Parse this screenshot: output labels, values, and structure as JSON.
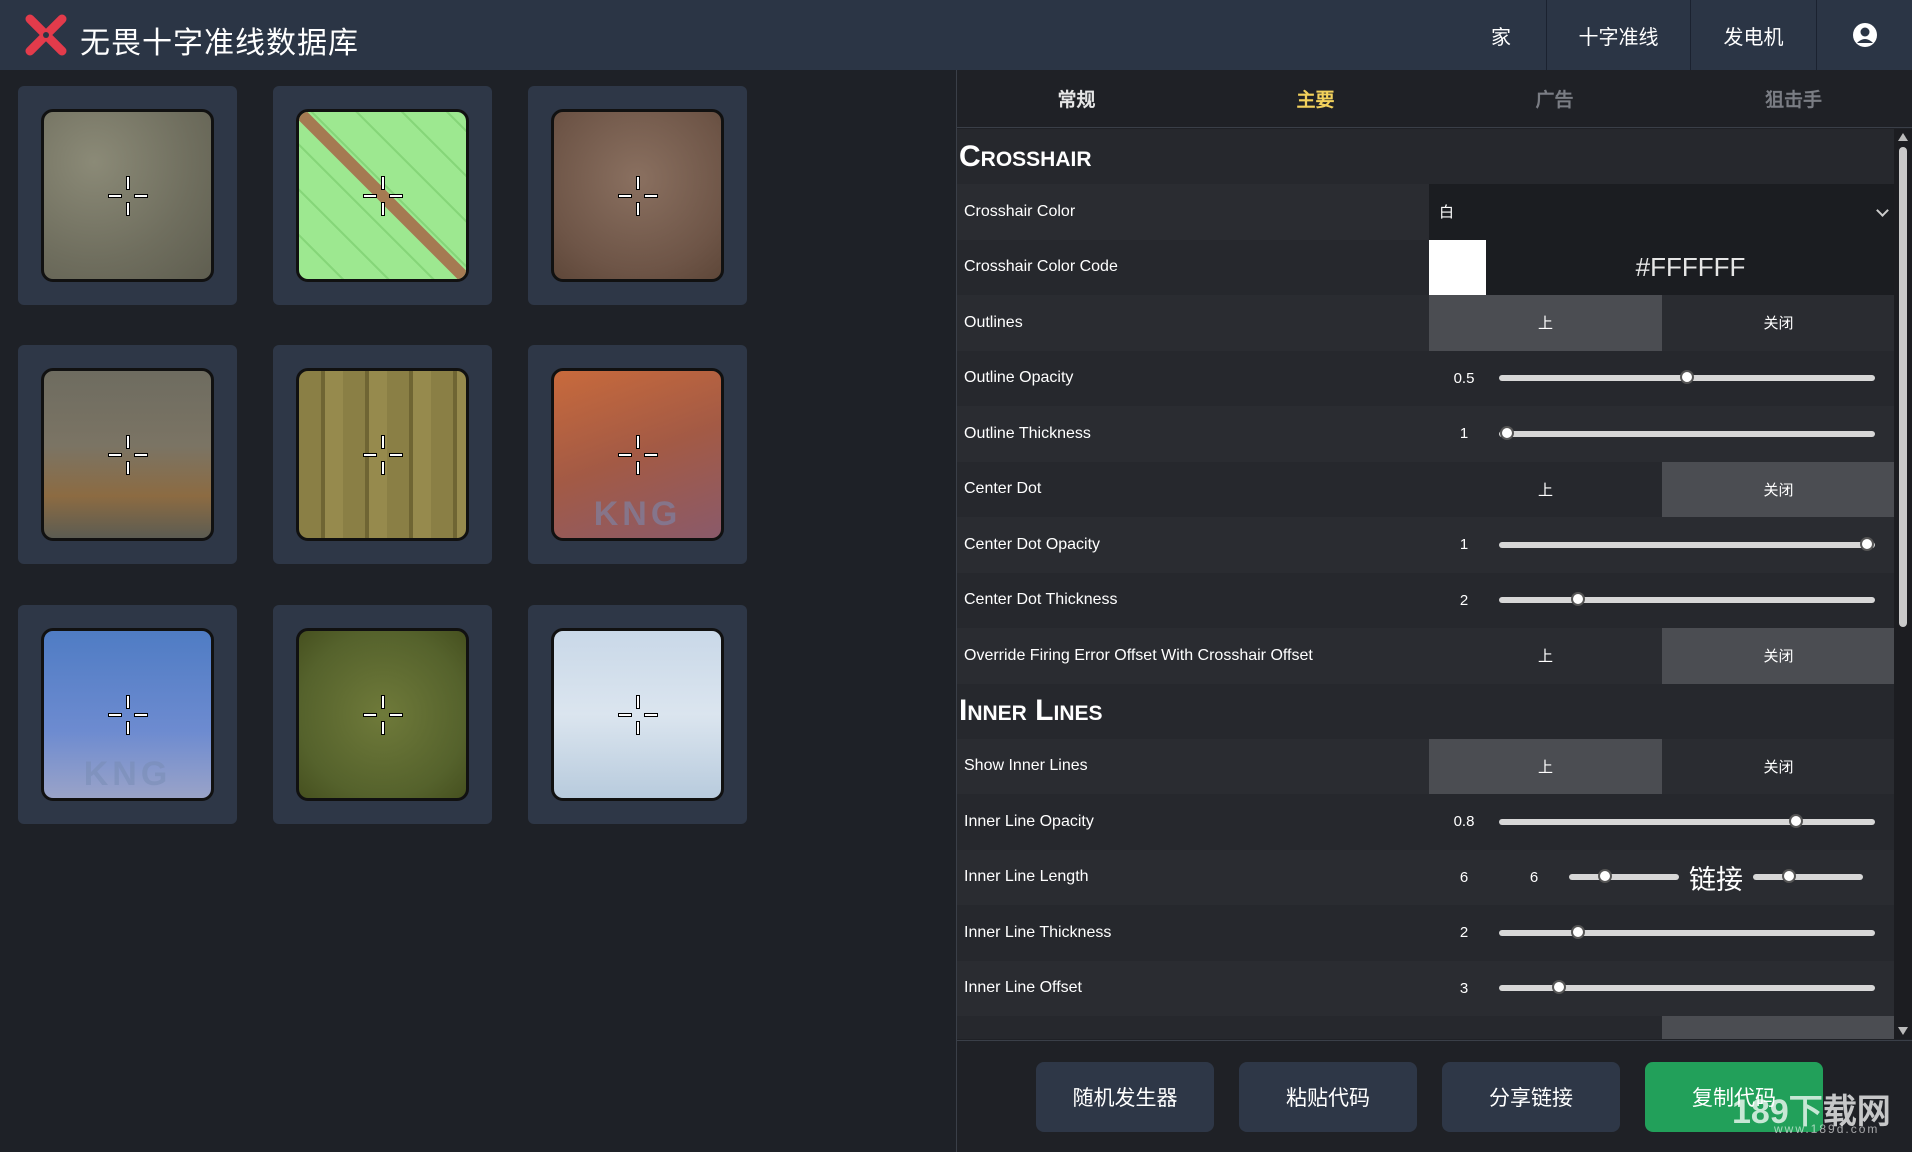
{
  "app": {
    "title": "无畏十字准线数据库"
  },
  "nav": {
    "home": "家",
    "crosshair": "十字准线",
    "generator": "发电机"
  },
  "grid": {
    "tiles": [
      {
        "bg": "bg1"
      },
      {
        "bg": "bg2"
      },
      {
        "bg": "bg3"
      },
      {
        "bg": "bg4"
      },
      {
        "bg": "bg5"
      },
      {
        "bg": "bg6",
        "logo_text": "KNG"
      },
      {
        "bg": "bg7",
        "logo_text": "KNG"
      },
      {
        "bg": "bg8"
      },
      {
        "bg": "bg9"
      }
    ]
  },
  "tabs": {
    "general": "常规",
    "primary": "主要",
    "ads": "广告",
    "sniper": "狙击手",
    "active": "primary"
  },
  "sections": {
    "crosshair": "Crosshair",
    "inner_lines": "Inner Lines"
  },
  "toggle": {
    "on": "上",
    "off": "关闭"
  },
  "crosshair": {
    "color": {
      "label": "Crosshair Color",
      "value": "白"
    },
    "color_code": {
      "label": "Crosshair Color Code",
      "value": "#FFFFFF",
      "swatch": "#ffffff"
    },
    "outlines": {
      "label": "Outlines",
      "state": "on"
    },
    "outline_opacity": {
      "label": "Outline Opacity",
      "value": "0.5",
      "fraction": 0.5
    },
    "outline_thickness": {
      "label": "Outline Thickness",
      "value": "1",
      "fraction": 0.02
    },
    "center_dot": {
      "label": "Center Dot",
      "state": "off"
    },
    "center_dot_opacity": {
      "label": "Center Dot Opacity",
      "value": "1",
      "fraction": 0.98
    },
    "center_dot_thickness": {
      "label": "Center Dot Thickness",
      "value": "2",
      "fraction": 0.21
    },
    "override_firing": {
      "label": "Override Firing Error Offset With Crosshair Offset",
      "state": "off"
    }
  },
  "inner": {
    "show": {
      "label": "Show Inner Lines",
      "state": "on"
    },
    "opacity": {
      "label": "Inner Line Opacity",
      "value": "0.8",
      "fraction": 0.79
    },
    "length": {
      "label": "Inner Line Length",
      "value": "6",
      "value2": "6",
      "fraction": 0.33,
      "fraction2": 0.33,
      "link_label": "链接"
    },
    "thickness": {
      "label": "Inner Line Thickness",
      "value": "2",
      "fraction": 0.21
    },
    "offset": {
      "label": "Inner Line Offset",
      "value": "3",
      "fraction": 0.16
    }
  },
  "footer": {
    "random": "随机发生器",
    "paste": "粘贴代码",
    "share": "分享链接",
    "copy": "复制代码"
  },
  "watermark": {
    "main": "189下载网",
    "sub": "www.189d.com"
  },
  "colors": {
    "header": "#2b3545",
    "accent_tab": "#f2d15c",
    "copy_button": "#22a05a"
  }
}
